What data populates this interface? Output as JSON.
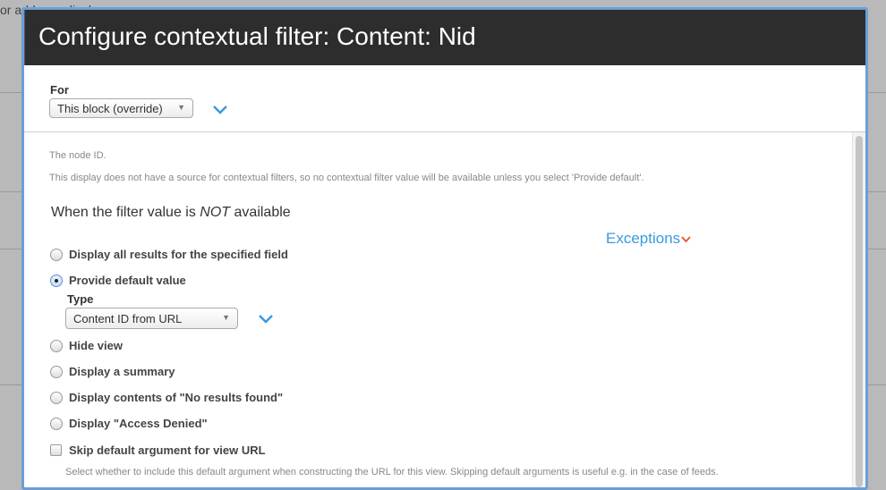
{
  "background": {
    "text": "or add new displays"
  },
  "dialog": {
    "title": "Configure contextual filter: Content: Nid",
    "for_label": "For",
    "for_value": "This block (override)",
    "description": "The node ID.",
    "notice": "This display does not have a source for contextual filters, so no contextual filter value will be available unless you select 'Provide default'.",
    "section_heading_pre": "When the filter value is ",
    "section_heading_em": "NOT",
    "section_heading_post": " available",
    "exceptions_label": "Exceptions",
    "options": [
      {
        "label": "Display all results for the specified field",
        "selected": false
      },
      {
        "label": "Provide default value",
        "selected": true
      },
      {
        "label": "Hide view",
        "selected": false
      },
      {
        "label": "Display a summary",
        "selected": false
      },
      {
        "label": "Display contents of \"No results found\"",
        "selected": false
      },
      {
        "label": "Display \"Access Denied\"",
        "selected": false
      }
    ],
    "type_label": "Type",
    "type_value": "Content ID from URL",
    "skip_label": "Skip default argument for view URL",
    "skip_checked": false,
    "skip_help": "Select whether to include this default argument when constructing the URL for this view. Skipping default arguments is useful e.g. in the case of feeds."
  },
  "colors": {
    "accent": "#3a9ae0",
    "titlebar": "#2d2d2d",
    "exceptions_chevron": "#e8562a",
    "dialog_border": "#6a9fd9"
  }
}
